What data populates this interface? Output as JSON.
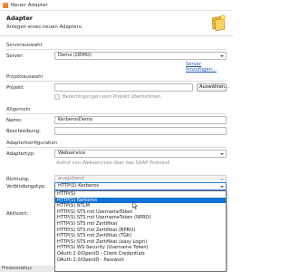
{
  "window": {
    "title": "Neuer Adapter"
  },
  "header": {
    "title": "Adapter",
    "subtitle": "Anlegen eines neuen Adapters."
  },
  "server_group": {
    "label": "Serverauswahl",
    "server_label": "Server:",
    "server_value": "Demo (DEMO)",
    "link": "Server hinzufügen..."
  },
  "project_group": {
    "label": "Projektauswahl",
    "project_label": "Projekt:",
    "project_value": "",
    "choose_button": "Auswählen...",
    "checkbox_label": "Berechtigungen vom Projekt übernehmen"
  },
  "general_group": {
    "label": "Allgemein",
    "name_label": "Name:",
    "name_value": "KerberosDemo",
    "desc_label": "Beschreibung:",
    "desc_value": ""
  },
  "config_group": {
    "label": "Adapterkonfiguration",
    "type_label": "Adaptertyp:",
    "type_value": "Webservice",
    "type_hint": "Aufruf von Webservices über das SOAP-Protokoll",
    "direction_label": "Richtung:",
    "direction_value": "ausgehend",
    "conn_label": "Verbindungstyp:",
    "conn_value": "HTTP(S) Kerberos",
    "active_label": "Aktiviert:"
  },
  "dropdown": {
    "options": [
      "HTTP(S)",
      "HTTP(S) Kerberos",
      "HTTP(S) NTLM",
      "HTTP(S) STS mit UsernameToken",
      "HTTP(S) STS mit UsernameToken (NPRO)",
      "HTTP(S) STS mit Zertifikat",
      "HTTP(S) STS mit Zertifikat (BPRO)",
      "HTTP(S) STS mit Zertifikat (TGK)",
      "HTTP(S) STS mit Zertifikat (easy Login)",
      "HTTP(S) WS-Security (Username Token)",
      "OAuth 2.0/OpenID - Client Credentials",
      "OAuth 2.0/OpenID - Passwort"
    ],
    "selected_index": 1
  },
  "statusbar": {
    "text": "Prozessstatus"
  }
}
